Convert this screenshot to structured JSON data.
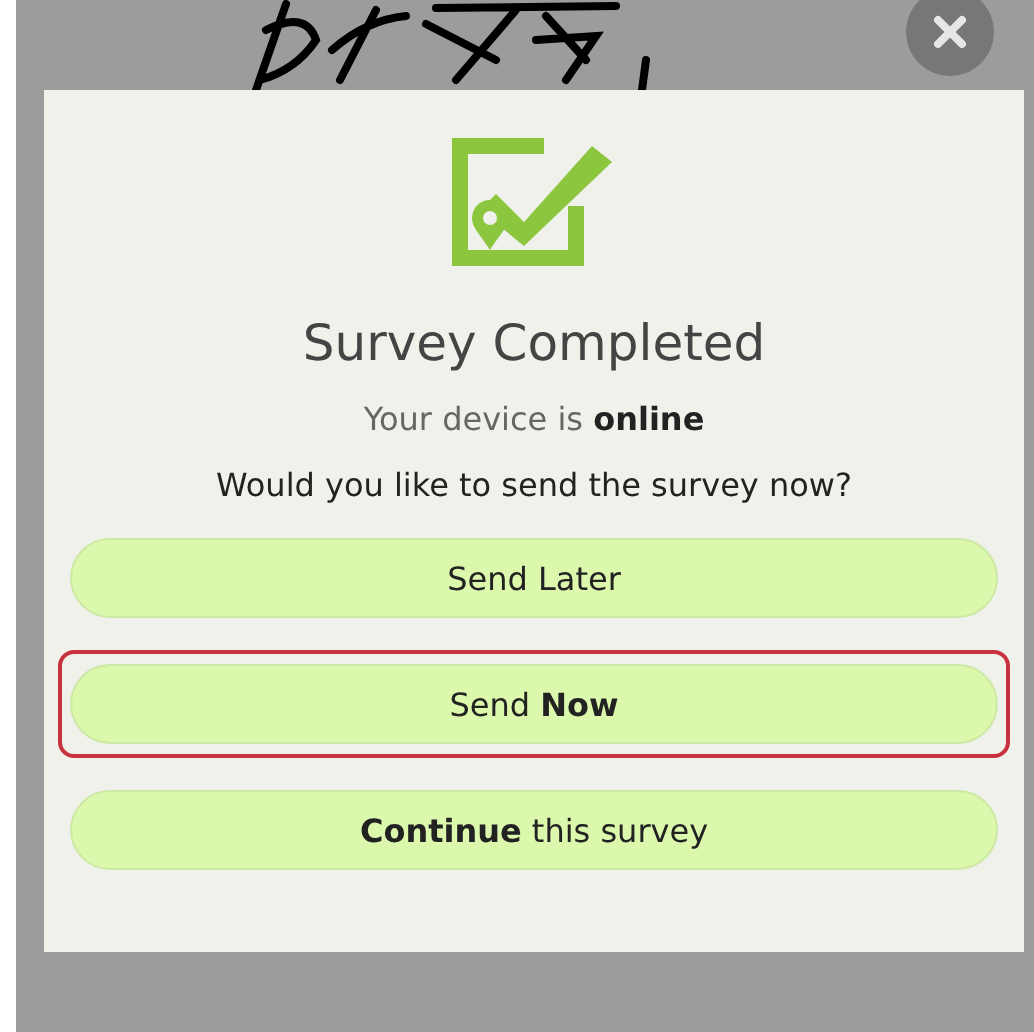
{
  "dialog": {
    "title": "Survey Completed",
    "status": "Your device is **online**",
    "question": "Would you like to send the survey now?",
    "buttons": [
      {
        "label": "Send Later",
        "highlighted": false
      },
      {
        "label": "Send **Now**",
        "highlighted": true
      },
      {
        "label": "**Continue** this survey",
        "highlighted": false
      }
    ]
  }
}
